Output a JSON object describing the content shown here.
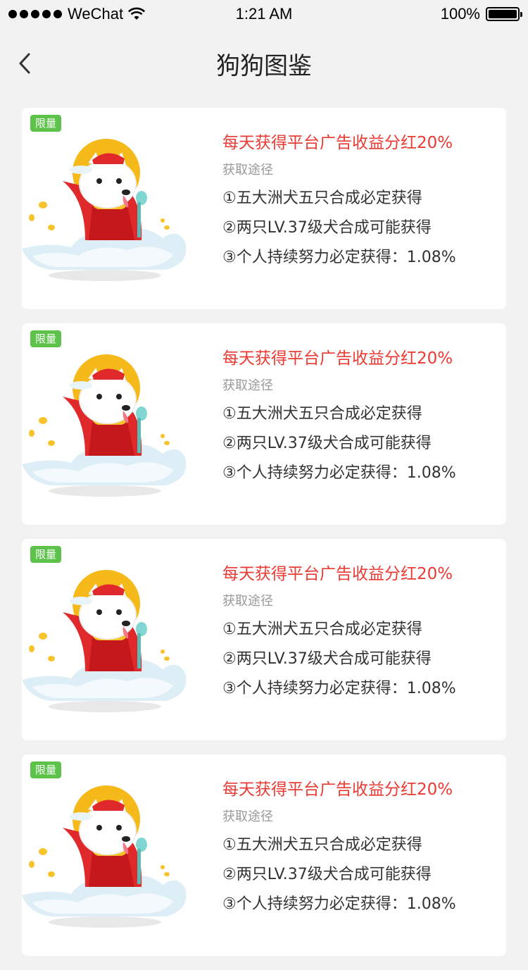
{
  "status_bar": {
    "carrier": "WeChat",
    "time": "1:21 AM",
    "battery": "100%"
  },
  "nav": {
    "title": "狗狗图鉴",
    "back_icon": "chevron-left-icon"
  },
  "cards": [
    {
      "badge": "限量",
      "headline": "每天获得平台广告收益分红20%",
      "subtitle": "获取途径",
      "methods": [
        "①五大洲犬五只合成必定获得",
        "②两只LV.37级犬合成可能获得",
        "③个人持续努力必定获得：1.08%"
      ]
    },
    {
      "badge": "限量",
      "headline": "每天获得平台广告收益分红20%",
      "subtitle": "获取途径",
      "methods": [
        "①五大洲犬五只合成必定获得",
        "②两只LV.37级犬合成可能获得",
        "③个人持续努力必定获得：1.08%"
      ]
    },
    {
      "badge": "限量",
      "headline": "每天获得平台广告收益分红20%",
      "subtitle": "获取途径",
      "methods": [
        "①五大洲犬五只合成必定获得",
        "②两只LV.37级犬合成可能获得",
        "③个人持续努力必定获得：1.08%"
      ]
    },
    {
      "badge": "限量",
      "headline": "每天获得平台广告收益分红20%",
      "subtitle": "获取途径",
      "methods": [
        "①五大洲犬五只合成必定获得",
        "②两只LV.37级犬合成可能获得",
        "③个人持续努力必定获得：1.08%"
      ]
    }
  ],
  "colors": {
    "background": "#f2f2f2",
    "badge": "#5dc24a",
    "headline": "#e93b34",
    "subtitle": "#999999"
  }
}
